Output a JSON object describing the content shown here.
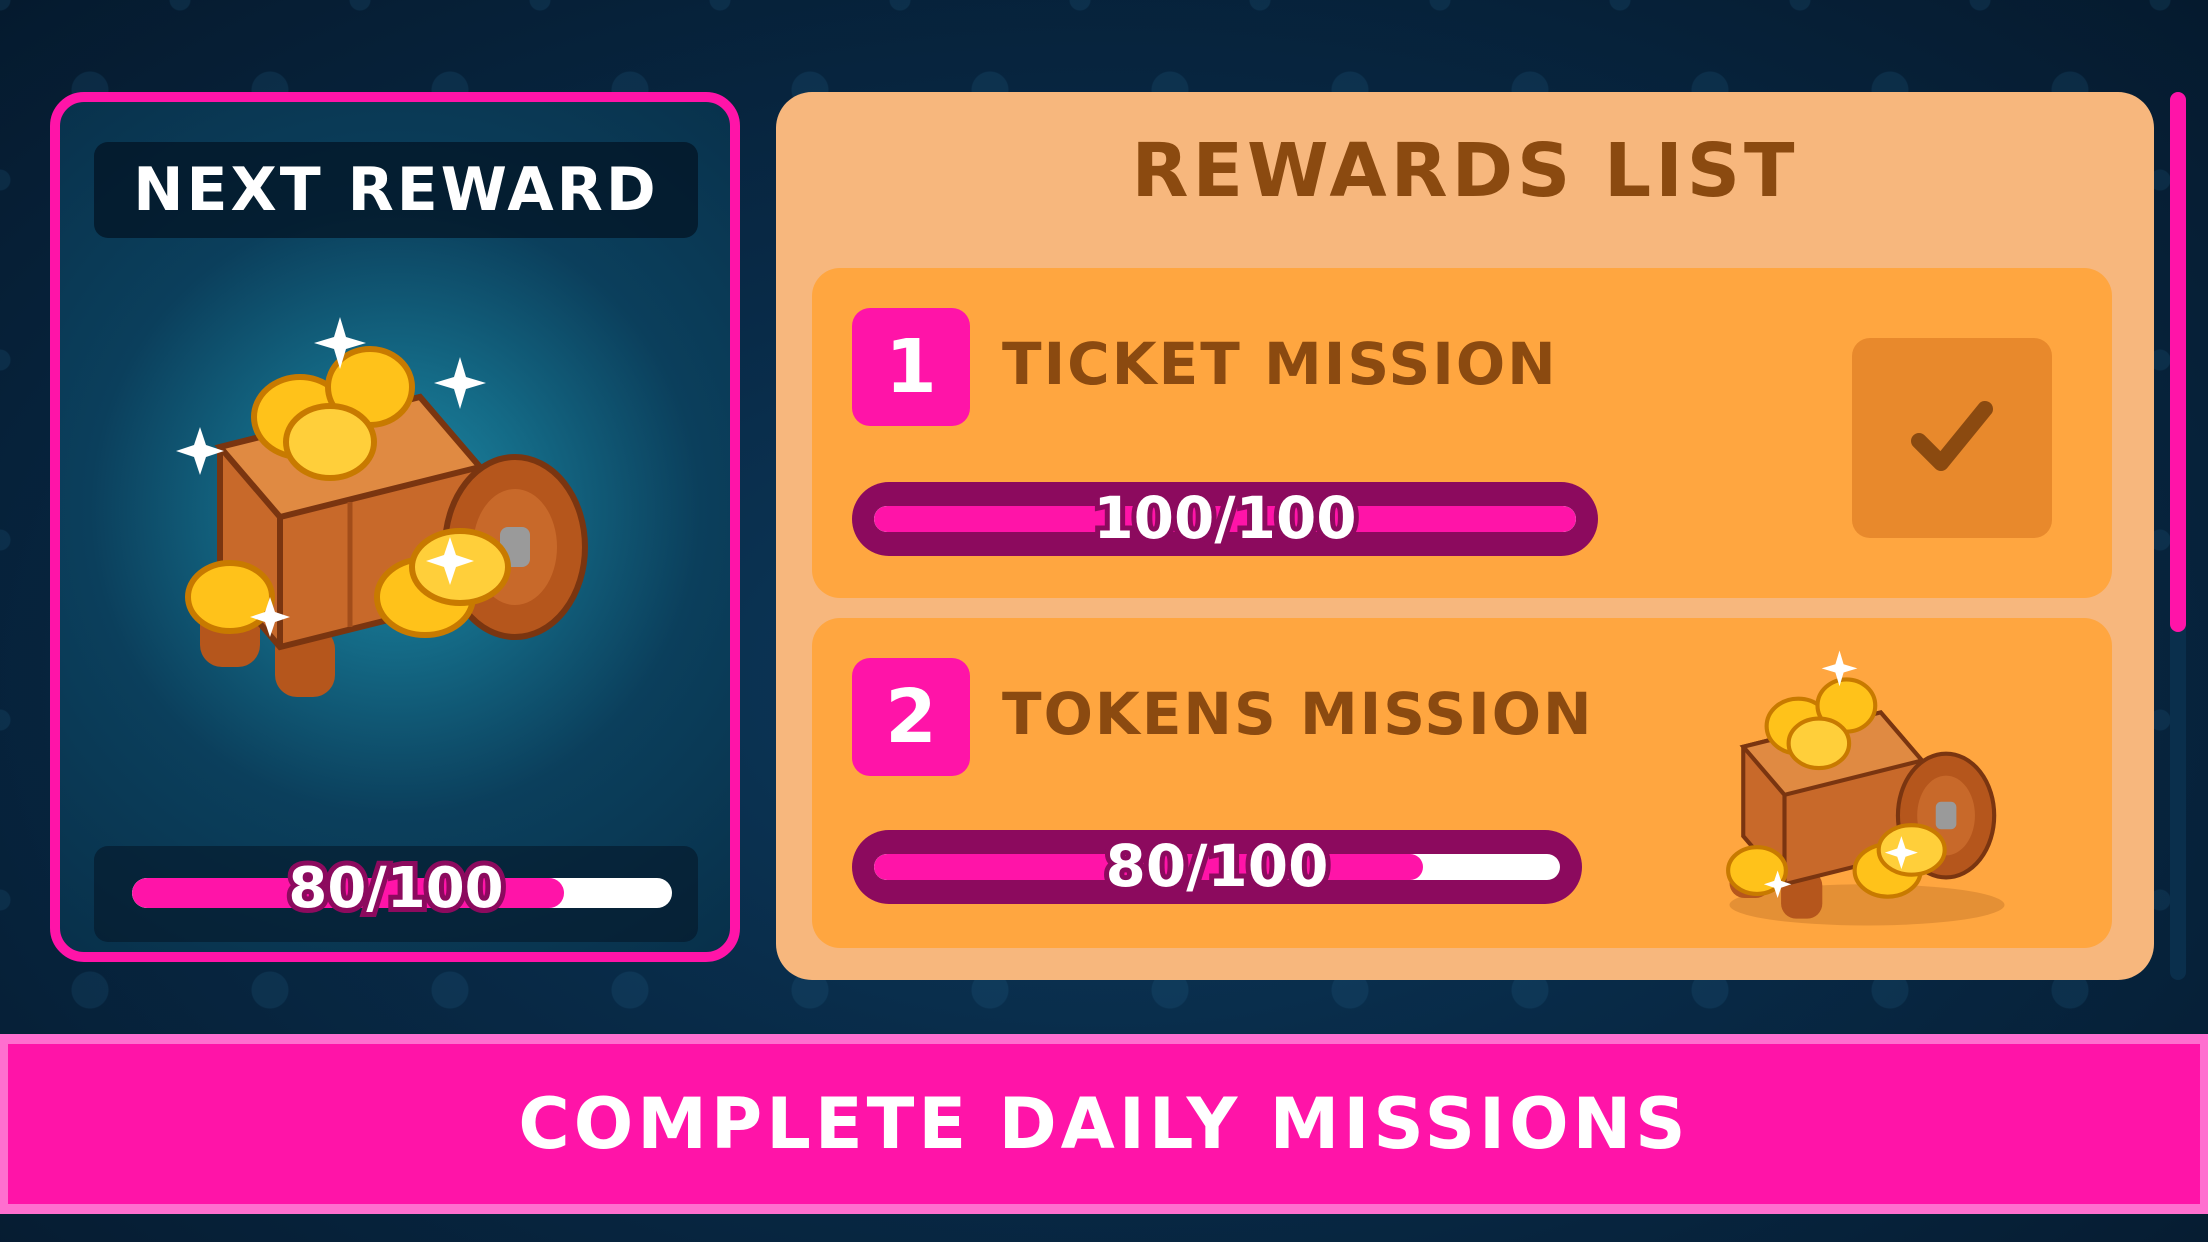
{
  "next_reward": {
    "title": "NEXT REWARD",
    "progress_text": "80/100",
    "progress_fraction": 0.8,
    "icon": "treasure-cart-icon"
  },
  "rewards_list": {
    "title": "REWARDS LIST",
    "missions": [
      {
        "number": "1",
        "name": "TICKET MISSION",
        "progress_text": "100/100",
        "progress_fraction": 1.0,
        "status_icon": "check-icon"
      },
      {
        "number": "2",
        "name": "TOKENS MISSION",
        "progress_text": "80/100",
        "progress_fraction": 0.8,
        "reward_icon": "treasure-cart-icon"
      }
    ]
  },
  "banner": {
    "text": "COMPLETE DAILY MISSIONS"
  },
  "colors": {
    "accent_pink": "#ff14a8",
    "panel_orange": "#f7b77d",
    "card_orange": "#ffa640",
    "text_brown": "#8b4a10",
    "bar_dark": "#8c0a5e"
  }
}
